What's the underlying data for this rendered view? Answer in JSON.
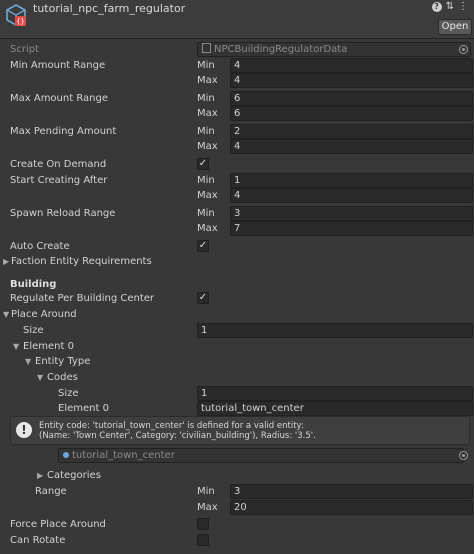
{
  "header": {
    "title": "tutorial_npc_farm_regulator",
    "open_label": "Open",
    "icons": [
      "help-icon",
      "preset-icon",
      "settings-icon"
    ]
  },
  "script_row": {
    "label": "Script",
    "value": "NPCBuildingRegulatorData"
  },
  "labels": {
    "min": "Min",
    "max": "Max",
    "size": "Size"
  },
  "fields": {
    "min_amount_range": {
      "label": "Min Amount Range",
      "min": "4",
      "max": "4"
    },
    "max_amount_range": {
      "label": "Max Amount Range",
      "min": "6",
      "max": "6"
    },
    "max_pending_amount": {
      "label": "Max Pending Amount",
      "min": "2",
      "max": "4"
    },
    "create_on_demand": {
      "label": "Create On Demand",
      "checked": true
    },
    "start_creating_after": {
      "label": "Start Creating After",
      "min": "1",
      "max": "4"
    },
    "spawn_reload_range": {
      "label": "Spawn Reload Range",
      "min": "3",
      "max": "7"
    },
    "auto_create": {
      "label": "Auto Create",
      "checked": true
    },
    "faction_entity_requirements": {
      "label": "Faction Entity Requirements"
    }
  },
  "building": {
    "header": "Building",
    "regulate_per_building_center": {
      "label": "Regulate Per Building Center",
      "checked": true
    },
    "place_around": {
      "label": "Place Around",
      "size": "1"
    },
    "element0": {
      "label": "Element 0",
      "entity_type": {
        "label": "Entity Type",
        "codes": {
          "label": "Codes",
          "size": "1",
          "element0_label": "Element 0",
          "element0_value": "tutorial_town_center"
        }
      },
      "help_line1": "Entity code: 'tutorial_town_center' is defined for a valid entity:",
      "help_line2": "(Name: 'Town Center', Category: 'civilian_building'), Radius: '3.5'.",
      "object_ref": "tutorial_town_center",
      "categories": {
        "label": "Categories"
      },
      "range": {
        "label": "Range",
        "min": "3",
        "max": "20"
      }
    },
    "force_place_around": {
      "label": "Force Place Around",
      "checked": false
    },
    "can_rotate": {
      "label": "Can Rotate",
      "checked": false
    }
  }
}
